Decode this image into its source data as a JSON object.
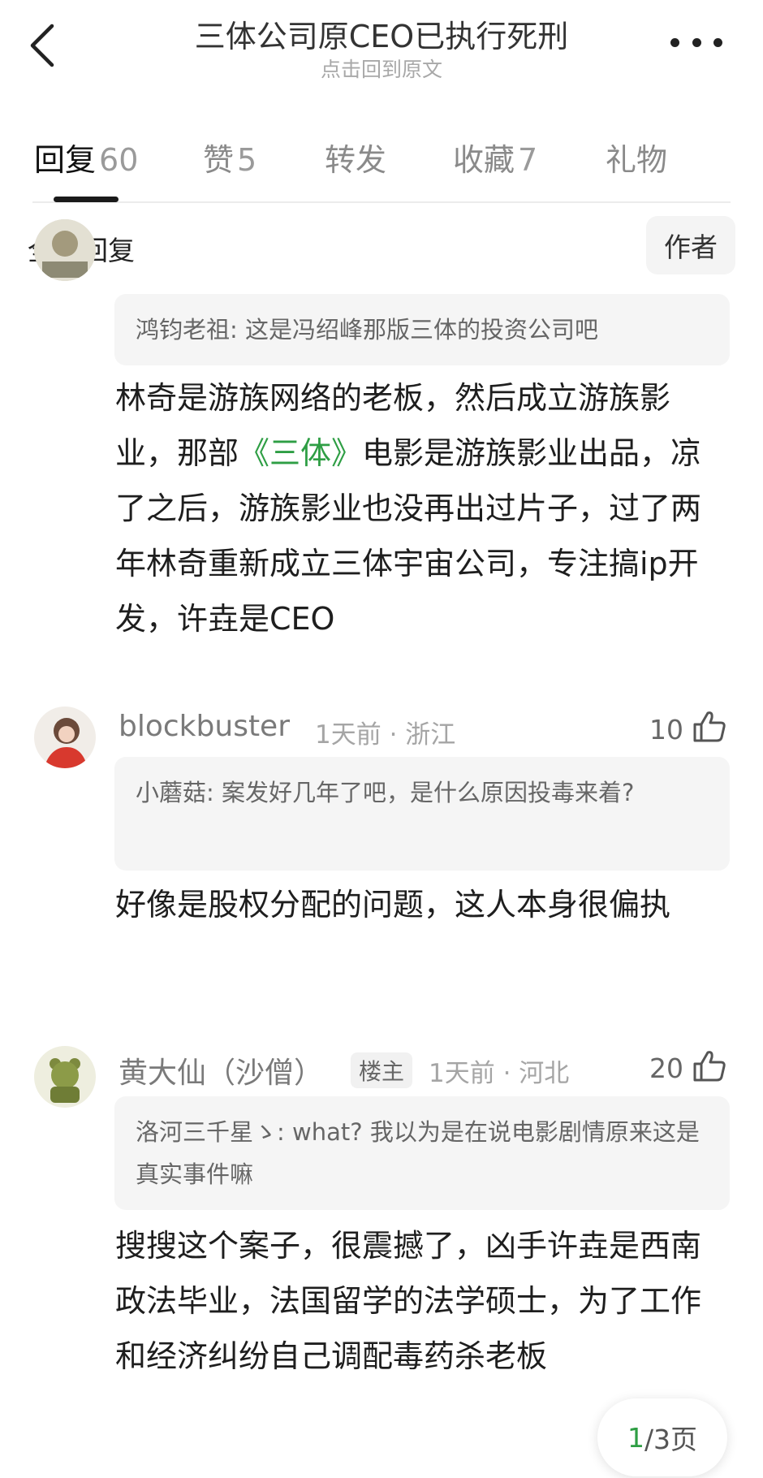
{
  "header": {
    "title": "三体公司原CEO已执行死刑",
    "subtitle": "点击回到原文"
  },
  "tabs": [
    {
      "label": "回复",
      "count": "60"
    },
    {
      "label": "赞",
      "count": "5"
    },
    {
      "label": "转发",
      "count": ""
    },
    {
      "label": "收藏",
      "count": "7"
    },
    {
      "label": "礼物",
      "count": ""
    }
  ],
  "filter": {
    "all_label": "全部回复",
    "author_label": "作者"
  },
  "comments": [
    {
      "quote_user": "鸿钧老祖",
      "quote_text": ": 这是冯绍峰那版三体的投资公司吧",
      "body_pre": "林奇是游族网络的老板，然后成立游族影业，那部",
      "body_link": "《三体》",
      "body_post": "电影是游族影业出品，凉了之后，游族影业也没再出过片子，过了两年林奇重新成立三体宇宙公司，专注搞ip开发，许垚是CEO"
    },
    {
      "username": "blockbuster",
      "time": "1天前",
      "location": "浙江",
      "likes": "10",
      "quote_user": "小蘑菇",
      "quote_text": ": 案发好几年了吧，是什么原因投毒来着?",
      "body": "好像是股权分配的问题，这人本身很偏执"
    },
    {
      "username": "黄大仙（沙僧）",
      "badge": "楼主",
      "time": "1天前",
      "location": "河北",
      "likes": "20",
      "quote_user": "洛河三千星ゝ",
      "quote_text": ": what?  我以为是在说电影剧情原来这是真实事件嘛",
      "body": "搜搜这个案子，很震撼了，凶手许垚是西南政法毕业，法国留学的法学硕士，为了工作和经济纠纷自己调配毒药杀老板"
    }
  ],
  "meta_separator": " · ",
  "pager": {
    "current": "1",
    "total_text": "/3页"
  },
  "colors": {
    "accent_green": "#2e9e44",
    "quote_bg": "#f5f5f5"
  }
}
